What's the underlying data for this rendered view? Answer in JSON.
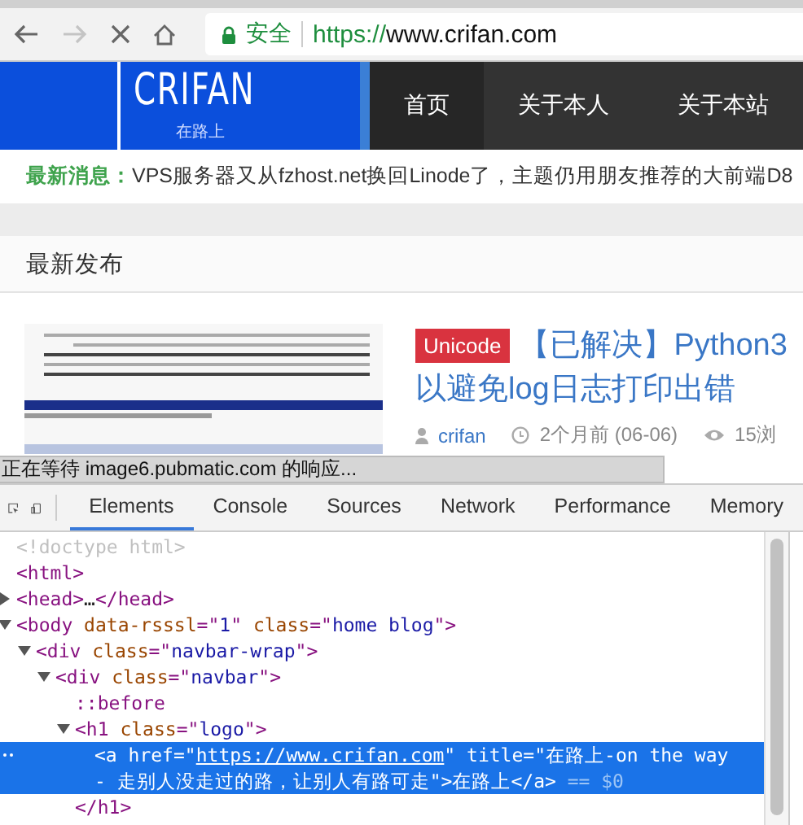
{
  "browser": {
    "back_disabled": false,
    "forward_disabled": true,
    "security_label": "安全",
    "url_scheme": "https://",
    "url_host": "www.crifan.com"
  },
  "site": {
    "logo_title": "CRIFAN",
    "logo_subtitle": "在路上",
    "nav": [
      {
        "label": "首页",
        "selected": true
      },
      {
        "label": "关于本人",
        "selected": false
      },
      {
        "label": "关于本站",
        "selected": false
      }
    ],
    "news_label": "最新消息：",
    "news_text": "VPS服务器又从fzhost.net换回Linode了，主题仍用朋友推荐的大前端D8",
    "section_title": "最新发布",
    "post": {
      "tag": "Unicode",
      "title": "【已解决】Python3",
      "title_line2": "以避免log日志打印出错",
      "author": "crifan",
      "time": "2个月前 (06-06)",
      "views": "15浏"
    },
    "status_text": "正在等待 image6.pubmatic.com 的响应..."
  },
  "devtools": {
    "tabs": [
      {
        "label": "Elements",
        "selected": true
      },
      {
        "label": "Console",
        "selected": false
      },
      {
        "label": "Sources",
        "selected": false
      },
      {
        "label": "Network",
        "selected": false
      },
      {
        "label": "Performance",
        "selected": false
      },
      {
        "label": "Memory",
        "selected": false
      }
    ],
    "dom_tree": [
      {
        "tokens": [
          {
            "kind": "doctype",
            "text": "<!doctype html>"
          }
        ],
        "selected": false
      },
      {
        "tokens": [
          {
            "kind": "tag",
            "text": "<html>"
          }
        ],
        "selected": false,
        "children": [
          {
            "tokens": [
              {
                "kind": "tag",
                "text": "<head>"
              },
              {
                "kind": "text",
                "text": "…"
              },
              {
                "kind": "tag",
                "text": "</head>"
              }
            ],
            "expanded": false,
            "selected": false
          },
          {
            "tokens": [
              {
                "kind": "tag",
                "text": "<body "
              },
              {
                "kind": "attr",
                "text": "data-rsssl"
              },
              {
                "kind": "tag",
                "text": "=\""
              },
              {
                "kind": "value",
                "text": "1"
              },
              {
                "kind": "tag",
                "text": "\" "
              },
              {
                "kind": "attr",
                "text": "class"
              },
              {
                "kind": "tag",
                "text": "=\""
              },
              {
                "kind": "value",
                "text": "home blog"
              },
              {
                "kind": "tag",
                "text": "\">"
              }
            ],
            "expanded": true,
            "selected": false,
            "children": [
              {
                "tokens": [
                  {
                    "kind": "tag",
                    "text": "<div "
                  },
                  {
                    "kind": "attr",
                    "text": "class"
                  },
                  {
                    "kind": "tag",
                    "text": "=\""
                  },
                  {
                    "kind": "value",
                    "text": "navbar-wrap"
                  },
                  {
                    "kind": "tag",
                    "text": "\">"
                  }
                ],
                "expanded": true,
                "selected": false,
                "children": [
                  {
                    "tokens": [
                      {
                        "kind": "tag",
                        "text": "<div "
                      },
                      {
                        "kind": "attr",
                        "text": "class"
                      },
                      {
                        "kind": "tag",
                        "text": "=\""
                      },
                      {
                        "kind": "value",
                        "text": "navbar"
                      },
                      {
                        "kind": "tag",
                        "text": "\">"
                      }
                    ],
                    "expanded": true,
                    "selected": false,
                    "children": [
                      {
                        "tokens": [
                          {
                            "kind": "pseudo",
                            "text": "::before"
                          }
                        ],
                        "selected": false
                      },
                      {
                        "tokens": [
                          {
                            "kind": "tag",
                            "text": "<h1 "
                          },
                          {
                            "kind": "attr",
                            "text": "class"
                          },
                          {
                            "kind": "tag",
                            "text": "=\""
                          },
                          {
                            "kind": "value",
                            "text": "logo"
                          },
                          {
                            "kind": "tag",
                            "text": "\">"
                          }
                        ],
                        "expanded": true,
                        "selected": false,
                        "closing": "</h1>",
                        "children": [
                          {
                            "tokens": [
                              {
                                "kind": "tag",
                                "text": "<a "
                              },
                              {
                                "kind": "attr",
                                "text": "href"
                              },
                              {
                                "kind": "tag",
                                "text": "=\""
                              },
                              {
                                "kind": "link",
                                "text": "https://www.crifan.com"
                              },
                              {
                                "kind": "tag",
                                "text": "\" "
                              },
                              {
                                "kind": "attr",
                                "text": "title"
                              },
                              {
                                "kind": "tag",
                                "text": "=\""
                              },
                              {
                                "kind": "value",
                                "text": "在路上-on the way - 走别人没走过的路，让别人有路可走"
                              },
                              {
                                "kind": "tag",
                                "text": "\">"
                              },
                              {
                                "kind": "text",
                                "text": "在路上"
                              },
                              {
                                "kind": "tag",
                                "text": "</a>"
                              },
                              {
                                "kind": "marker",
                                "text": " == $0"
                              }
                            ],
                            "selected": true
                          }
                        ]
                      }
                    ]
                  }
                ]
              }
            ]
          }
        ]
      }
    ]
  }
}
